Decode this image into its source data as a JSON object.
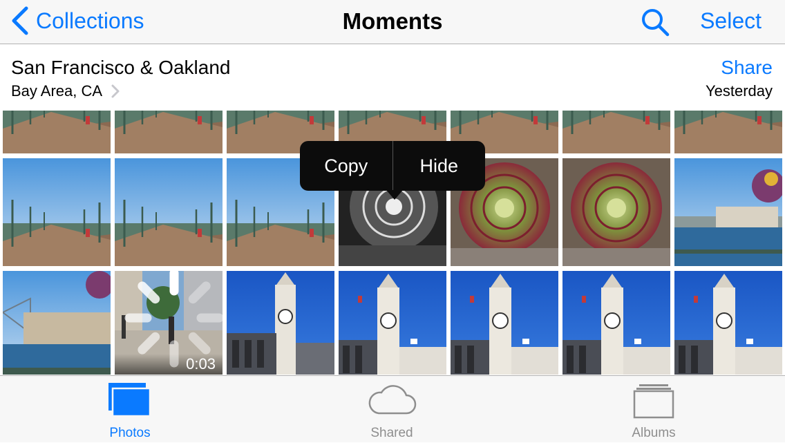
{
  "nav": {
    "back_label": "Collections",
    "title": "Moments",
    "select_label": "Select",
    "search_icon": "search-icon"
  },
  "moment": {
    "title": "San Francisco & Oakland",
    "location": "Bay Area, CA",
    "share_label": "Share",
    "date": "Yesterday"
  },
  "context_menu": {
    "copy_label": "Copy",
    "hide_label": "Hide"
  },
  "video": {
    "duration": "0:03"
  },
  "tabs": [
    {
      "label": "Photos",
      "icon": "photos-icon",
      "active": true
    },
    {
      "label": "Shared",
      "icon": "cloud-icon",
      "active": false
    },
    {
      "label": "Albums",
      "icon": "albums-icon",
      "active": false
    }
  ],
  "colors": {
    "accent": "#0a7aff",
    "inactive": "#8e8e8e",
    "bar_bg": "#f7f7f7"
  }
}
